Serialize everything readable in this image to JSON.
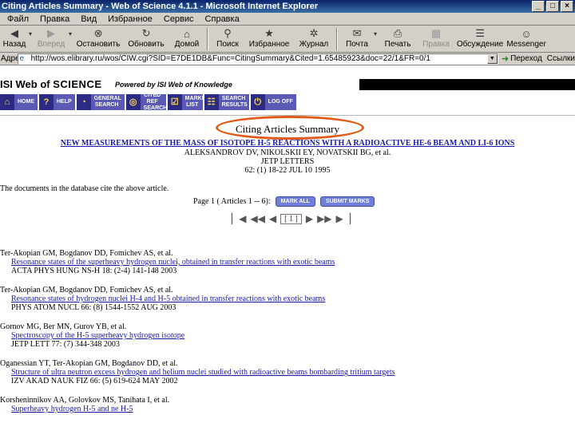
{
  "window": {
    "title": "Citing Articles Summary - Web of Science 4.1.1 - Microsoft Internet Explorer",
    "controls": [
      "_",
      "□",
      "×"
    ]
  },
  "menu": [
    "Файл",
    "Правка",
    "Вид",
    "Избранное",
    "Сервис",
    "Справка"
  ],
  "toolbar": {
    "back": "Назад",
    "forward": "Вперед",
    "stop": "Остановить",
    "refresh": "Обновить",
    "home": "Домой",
    "search": "Поиск",
    "favorites": "Избранное",
    "history": "Журнал",
    "mail": "Почта",
    "print": "Печать",
    "edit": "Правка",
    "discuss": "Обсуждение",
    "messenger": "Messenger"
  },
  "address": {
    "label": "Адрес",
    "url": "http://wos.elibrary.ru/wos/CIW.cgi?SID=E7DE1DB&Func=CitingSummary&Cited=1.65485923&doc=22/1&FR=0/1",
    "go": "Переход",
    "links": "Ссылки"
  },
  "wos": {
    "logo_prefix": "ISI Web of ",
    "logo_main": "SCIENCE",
    "powered": "Powered by ISI Web of Knowledge"
  },
  "nav": [
    {
      "text": "HOME",
      "icon": "⌂"
    },
    {
      "text": "HELP",
      "icon": "?"
    },
    {
      "text": "GENERAL SEARCH",
      "icon": "◔"
    },
    {
      "text": "CITED REF SEARCH",
      "icon": "◎"
    },
    {
      "text": "MARKED LIST",
      "icon": "☑"
    },
    {
      "text": "SEARCH RESULTS",
      "icon": "☷"
    },
    {
      "text": "LOG OFF",
      "icon": "⏻"
    }
  ],
  "summary": {
    "title": "Citing Articles  Summary",
    "cited_title": "NEW MEASUREMENTS OF THE MASS OF ISOTOPE H-5 REACTIONS WITH A RADIOACTIVE HE-6 BEAM AND LI-6 IONS",
    "cited_authors": "ALEKSANDROV DV, NIKOLSKII EY, NOVATSKII BG, et al.",
    "journal": "JETP LETTERS",
    "citation": "62: (1) 18-22 JUL 10 1995",
    "intro": "The documents in the database cite the above article.",
    "pager_text": "Page 1 ( Articles 1 -- 6):",
    "mark_all": "MARK ALL",
    "submit_marks": "SUBMIT MARKS",
    "current_page": "[ 1 ]"
  },
  "records": [
    {
      "authors": "Ter-Akopian GM, Bogdanov DD, Fomichev AS, et al.",
      "title": "Resonance states of the superheavy hydrogen nuclei, obtained in transfer reactions with exotic beams",
      "source": "ACTA PHYS HUNG NS-H 18: (2-4) 141-148 2003"
    },
    {
      "authors": "Ter-Akopian GM, Bogdanov DD, Fomichev AS, et al.",
      "title": "Resonance states of hydrogen nuclei H-4 and H-5 obtained in transfer reactions with exotic beams",
      "source": "PHYS ATOM NUCL 66: (8) 1544-1552 AUG 2003"
    },
    {
      "authors": "Gornov MG, Ber MN, Gurov YB, et al.",
      "title": "Spectroscopy of the H-5 superheavy hydrogen isotope",
      "source": "JETP LETT 77: (7) 344-348 2003"
    },
    {
      "authors": "Oganessian YT, Ter-Akopian GM, Bogdanov DD, et al.",
      "title": "Structure of ultra neutron excess hydrogen and helium nuclei studied with radioactive beams bombarding tritium targets",
      "source": "IZV AKAD NAUK FIZ 66: (5) 619-624 MAY 2002"
    },
    {
      "authors": "Korsheninnikov AA, Golovkov MS, Tanihata I, et al.",
      "title": "Superheavy hydrogen H-5 and ne H-5",
      "source": ""
    }
  ]
}
